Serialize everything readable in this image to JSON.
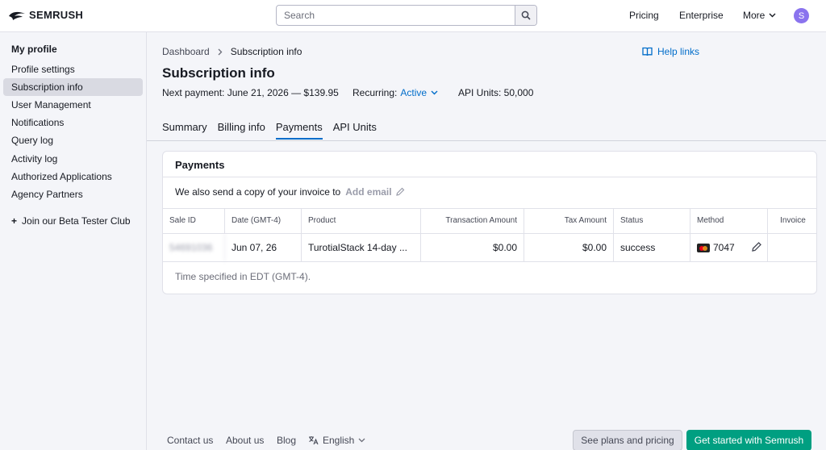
{
  "header": {
    "logo_text": "SEMRUSH",
    "search_placeholder": "Search",
    "nav": {
      "pricing": "Pricing",
      "enterprise": "Enterprise",
      "more": "More"
    },
    "avatar_initial": "S"
  },
  "sidebar": {
    "title": "My profile",
    "items": [
      {
        "label": "Profile settings"
      },
      {
        "label": "Subscription info",
        "active": true
      },
      {
        "label": "User Management"
      },
      {
        "label": "Notifications"
      },
      {
        "label": "Query log"
      },
      {
        "label": "Activity log"
      },
      {
        "label": "Authorized Applications"
      },
      {
        "label": "Agency Partners"
      }
    ],
    "beta": "Join our Beta Tester Club"
  },
  "breadcrumb": {
    "root": "Dashboard",
    "current": "Subscription info"
  },
  "help_links": "Help links",
  "page": {
    "title": "Subscription info",
    "next_payment": "Next payment: June 21, 2026 — $139.95",
    "recurring_label": "Recurring:",
    "recurring_value": "Active",
    "api_units": "API Units: 50,000"
  },
  "tabs": [
    {
      "label": "Summary"
    },
    {
      "label": "Billing info"
    },
    {
      "label": "Payments",
      "active": true
    },
    {
      "label": "API Units"
    }
  ],
  "payments": {
    "title": "Payments",
    "invoice_note": "We also send a copy of your invoice to",
    "add_email": "Add email",
    "columns": {
      "sale_id": "Sale ID",
      "date": "Date (GMT-4)",
      "product": "Product",
      "transaction": "Transaction Amount",
      "tax": "Tax Amount",
      "status": "Status",
      "method": "Method",
      "invoice": "Invoice"
    },
    "row": {
      "sale_id": "54691036",
      "date": "Jun 07, 26",
      "product": "TurotialStack 14-day ...",
      "transaction": "$0.00",
      "tax": "$0.00",
      "status": "success",
      "method": "7047"
    },
    "time_note": "Time specified in EDT (GMT-4)."
  },
  "footer": {
    "contact": "Contact us",
    "about": "About us",
    "blog": "Blog",
    "language": "English",
    "see_plans": "See plans and pricing",
    "get_started": "Get started with Semrush"
  },
  "colors": {
    "accent": "#006dca",
    "primary_button": "#009f81",
    "avatar": "#8a73ee"
  }
}
